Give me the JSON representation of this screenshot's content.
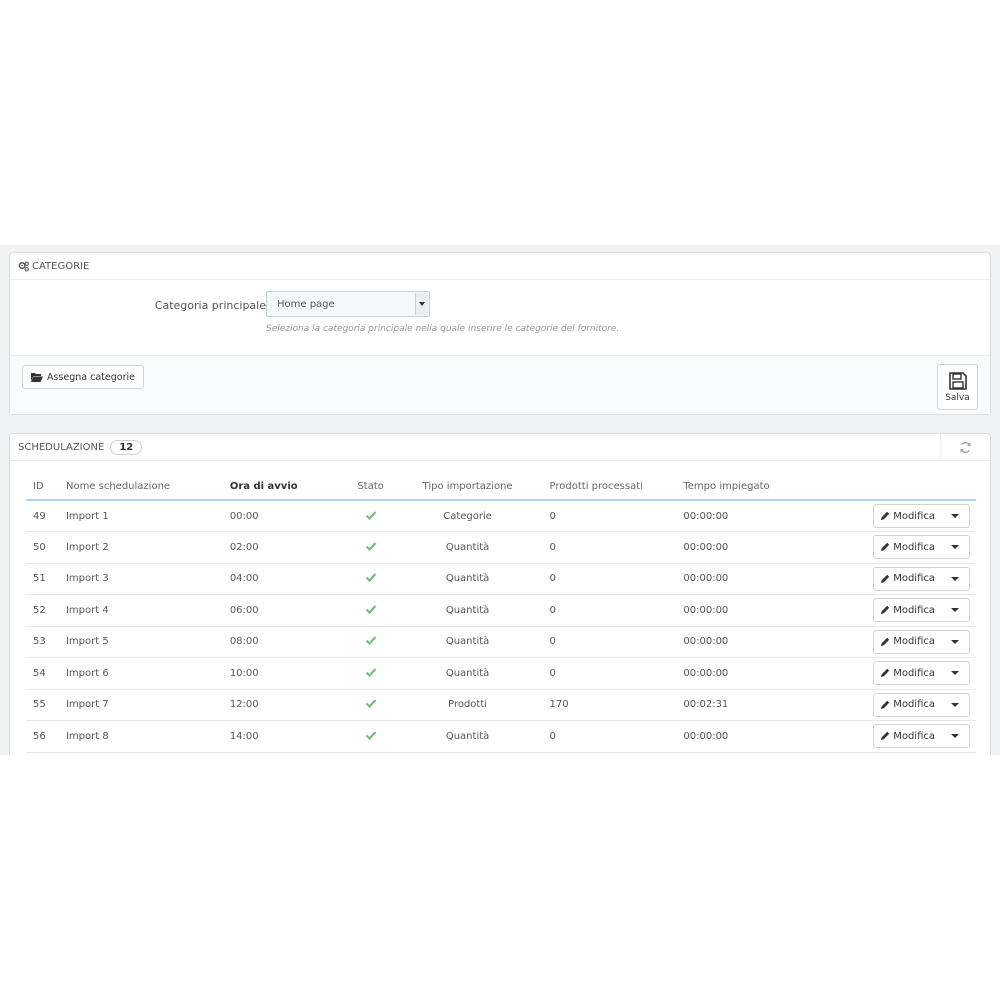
{
  "categories_panel": {
    "title": "CATEGORIE",
    "main_category_label": "Categoria principale",
    "main_category_value": "Home page",
    "help_text": "Seleziona la categoria principale nella quale inserire le categorie del fornitore.",
    "assign_button": "Assegna categorie",
    "save_button": "Salva"
  },
  "schedule_panel": {
    "title": "SCHEDULAZIONE",
    "count": "12",
    "columns": {
      "id": "ID",
      "name": "Nome schedulazione",
      "start_time": "Ora di avvio",
      "status": "Stato",
      "import_type": "Tipo importazione",
      "processed": "Prodotti processati",
      "elapsed": "Tempo impiegato"
    },
    "edit_label": "Modifica",
    "rows": [
      {
        "id": "49",
        "name": "Import 1",
        "time": "00:00",
        "type": "Categorie",
        "processed": "0",
        "elapsed": "00:00:00"
      },
      {
        "id": "50",
        "name": "Import 2",
        "time": "02:00",
        "type": "Quantità",
        "processed": "0",
        "elapsed": "00:00:00"
      },
      {
        "id": "51",
        "name": "Import 3",
        "time": "04:00",
        "type": "Quantità",
        "processed": "0",
        "elapsed": "00:00:00"
      },
      {
        "id": "52",
        "name": "Import 4",
        "time": "06:00",
        "type": "Quantità",
        "processed": "0",
        "elapsed": "00:00:00"
      },
      {
        "id": "53",
        "name": "Import 5",
        "time": "08:00",
        "type": "Quantità",
        "processed": "0",
        "elapsed": "00:00:00"
      },
      {
        "id": "54",
        "name": "Import 6",
        "time": "10:00",
        "type": "Quantità",
        "processed": "0",
        "elapsed": "00:00:00"
      },
      {
        "id": "55",
        "name": "Import 7",
        "time": "12:00",
        "type": "Prodotti",
        "processed": "170",
        "elapsed": "00:02:31"
      },
      {
        "id": "56",
        "name": "Import 8",
        "time": "14:00",
        "type": "Quantità",
        "processed": "0",
        "elapsed": "00:00:00"
      }
    ]
  },
  "colors": {
    "check_green": "#72c279",
    "header_underline": "#a9d4e8",
    "background": "#eff1f2"
  }
}
